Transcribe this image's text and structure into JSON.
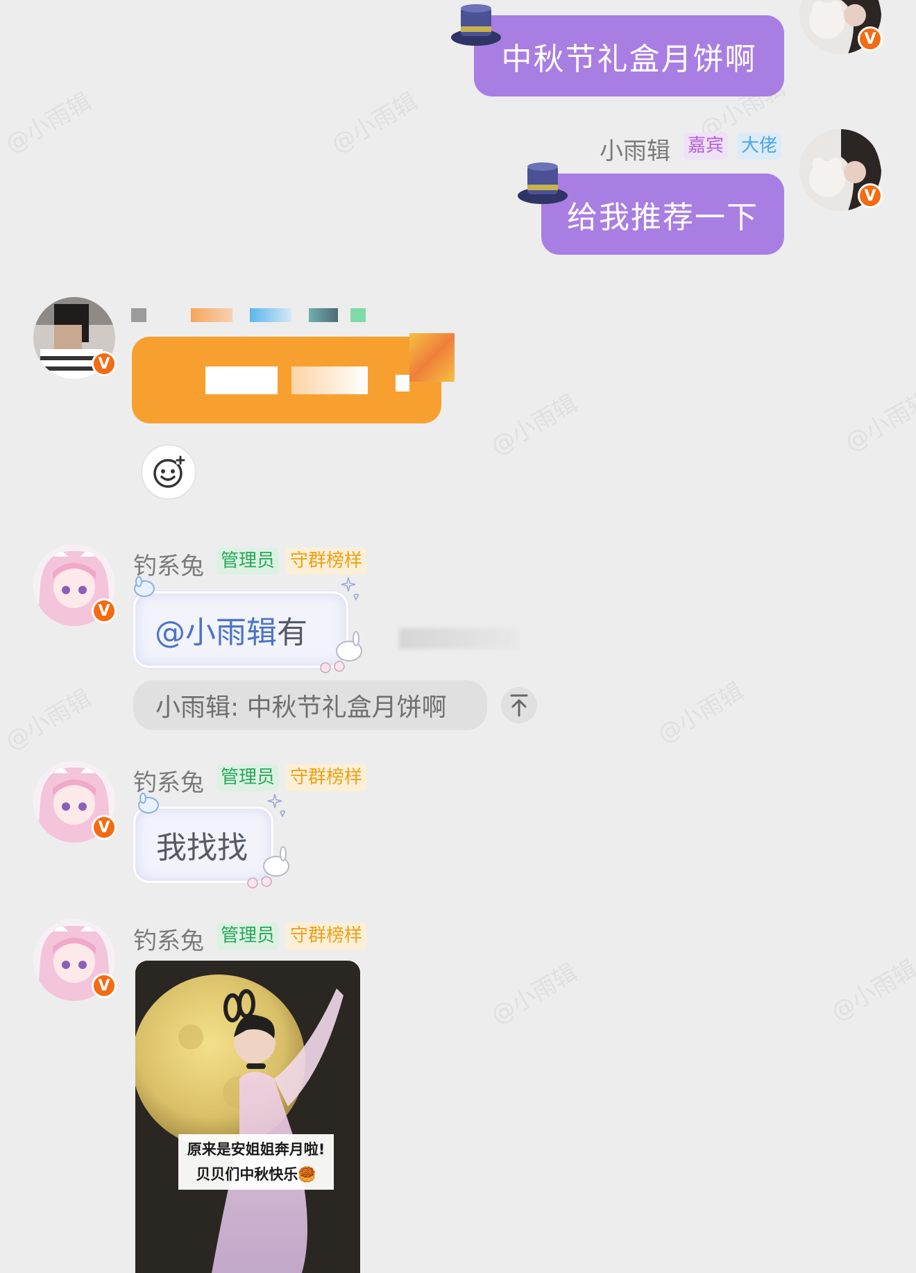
{
  "watermark": "@小雨辑",
  "messages": {
    "m1": {
      "text": "中秋节礼盒月饼啊"
    },
    "m2": {
      "sender": "小雨辑",
      "tags": [
        "嘉宾",
        "大佬"
      ],
      "text": "给我推荐一下"
    },
    "m4": {
      "sender": "钓系兔",
      "tags": [
        "管理员",
        "守群榜样"
      ],
      "mention": "@小雨辑",
      "text": " 有",
      "quote": "小雨辑: 中秋节礼盒月饼啊",
      "quote_jump_icon": "arrow-up-icon"
    },
    "m5": {
      "sender": "钓系兔",
      "tags": [
        "管理员",
        "守群榜样"
      ],
      "text": "我找找"
    },
    "m6": {
      "sender": "钓系兔",
      "tags": [
        "管理员",
        "守群榜样"
      ],
      "image_caption_line1": "原来是安姐姐奔月啦!",
      "image_caption_line2": "贝贝们中秋快乐🥮"
    }
  },
  "icons": {
    "verified": "V",
    "add_reaction": "emoji-add-icon"
  },
  "colors": {
    "sender_bubble": "#a97ee3",
    "orange_bubble": "#f7a030",
    "verified_badge": "#f36b12"
  }
}
